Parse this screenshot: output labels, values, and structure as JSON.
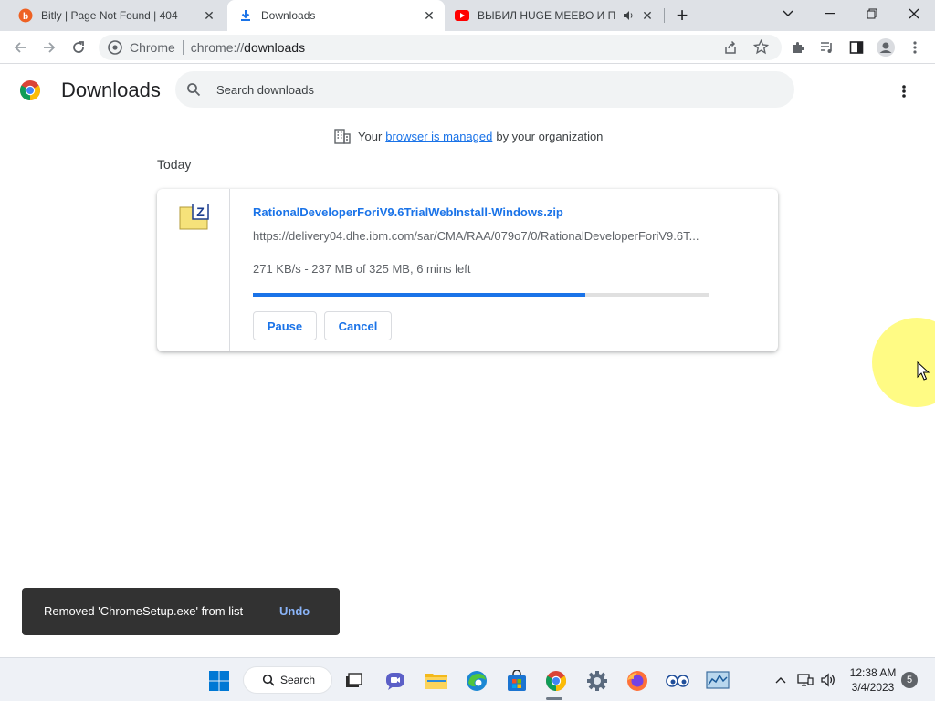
{
  "browser": {
    "tabs": [
      {
        "title": "Bitly | Page Not Found | 404",
        "active": false
      },
      {
        "title": "Downloads",
        "active": true
      },
      {
        "title": "ВЫБИЛ HUGE МЕЕВО И ПР",
        "active": false
      }
    ],
    "new_tab_label": "+",
    "omnibox": {
      "site": "Chrome",
      "url_scheme": "chrome://",
      "url_path": "downloads"
    }
  },
  "page": {
    "title": "Downloads",
    "search_placeholder": "Search downloads",
    "managed": {
      "prefix": "Your",
      "link": "browser is managed",
      "suffix": "by your organization"
    },
    "section_label": "Today",
    "download": {
      "file_name": "RationalDeveloperForiV9.6TrialWebInstall-Windows.zip",
      "url": "https://delivery04.dhe.ibm.com/sar/CMA/RAA/079o7/0/RationalDeveloperForiV9.6T...",
      "status": "271 KB/s - 237 MB of 325 MB, 6 mins left",
      "progress_fraction": 0.729,
      "pause_label": "Pause",
      "cancel_label": "Cancel"
    },
    "toast": {
      "message": "Removed 'ChromeSetup.exe' from list",
      "action": "Undo"
    }
  },
  "taskbar": {
    "search_label": "Search",
    "time": "12:38 AM",
    "date": "3/4/2023",
    "notification_count": "5"
  },
  "colors": {
    "accent": "#1a73e8",
    "tab_strip": "#dee1e6",
    "toast_bg": "#323232",
    "cursor_highlight": "#fff96e"
  }
}
